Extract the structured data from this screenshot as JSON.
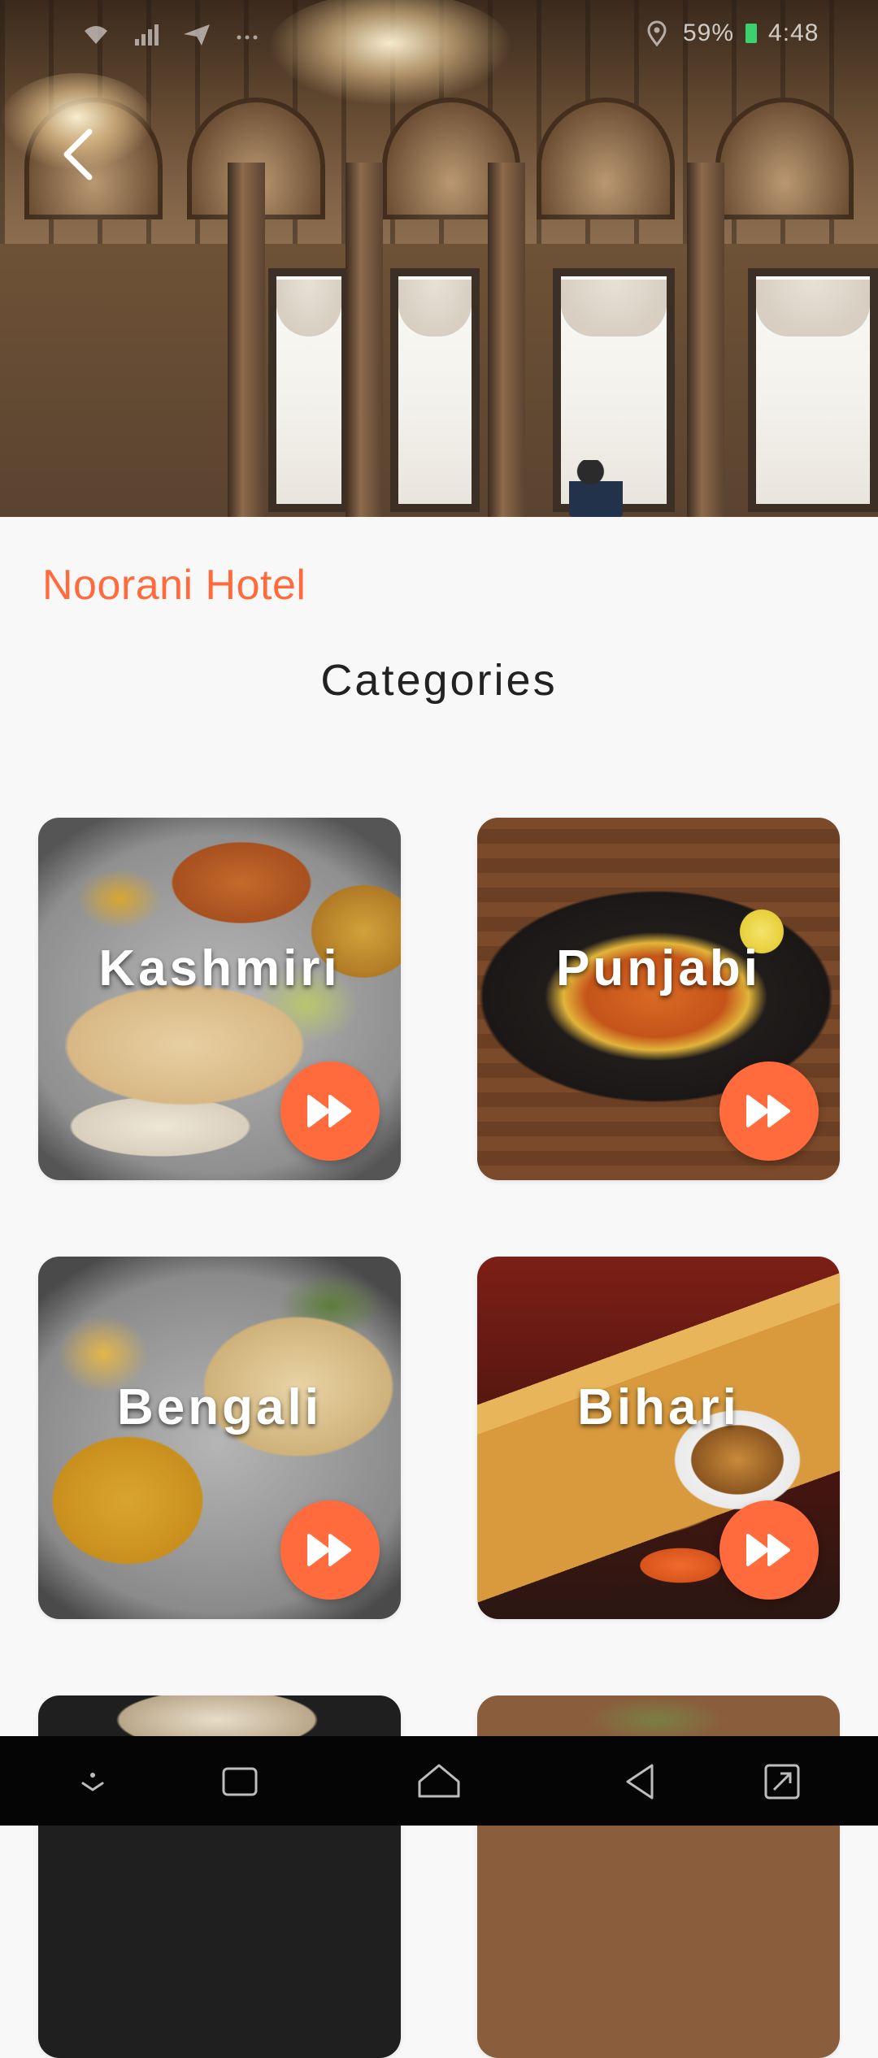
{
  "status_bar": {
    "battery_percent": "59%",
    "time": "4:48",
    "icons": [
      "wifi-icon",
      "signal-icon",
      "send-icon",
      "more-icon",
      "location-icon",
      "battery-icon"
    ]
  },
  "header": {
    "back_icon": "chevron-left-icon"
  },
  "hotel": {
    "name": "Noorani Hotel"
  },
  "section": {
    "title": "Categories"
  },
  "categories": [
    {
      "label": "Kashmiri",
      "action_icon": "fast-forward-icon"
    },
    {
      "label": "Punjabi",
      "action_icon": "fast-forward-icon"
    },
    {
      "label": "Bengali",
      "action_icon": "fast-forward-icon"
    },
    {
      "label": "Bihari",
      "action_icon": "fast-forward-icon"
    }
  ],
  "colors": {
    "accent": "#ff6b3d",
    "title_text": "#222222",
    "background": "#f8f8f9",
    "nav_bar": "#050505"
  },
  "nav_bar": {
    "icons": [
      "down-arrow-icon",
      "recent-apps-icon",
      "home-icon",
      "back-icon",
      "expand-icon"
    ]
  }
}
